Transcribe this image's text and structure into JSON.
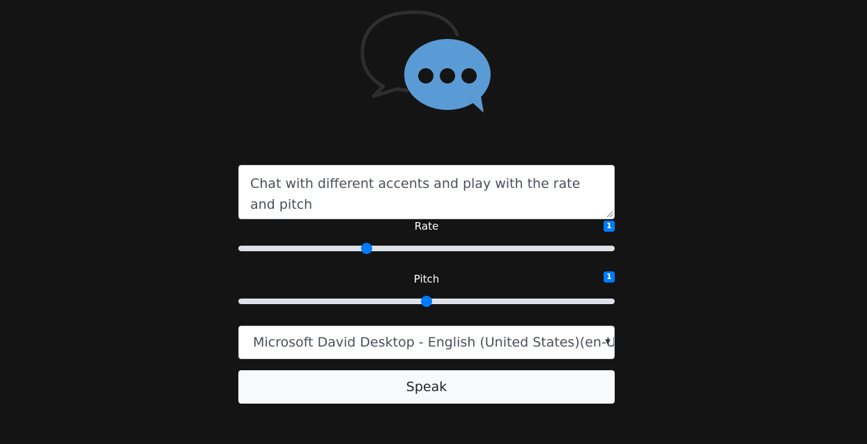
{
  "logo": {
    "icon": "chat-bubbles-icon"
  },
  "text_input": {
    "value": "Chat with different accents and play with the rate and pitch"
  },
  "rate": {
    "label": "Rate",
    "value": "1",
    "fraction": 0.34
  },
  "pitch": {
    "label": "Pitch",
    "value": "1",
    "fraction": 0.5
  },
  "voice_select": {
    "selected": "Microsoft David Desktop - English (United States)(en-US)"
  },
  "speak_button": {
    "label": "Speak"
  },
  "colors": {
    "background": "#141414",
    "accent": "#007bff",
    "bubble_blue": "#5b9bd5",
    "bubble_outline": "#2e2e2e"
  }
}
